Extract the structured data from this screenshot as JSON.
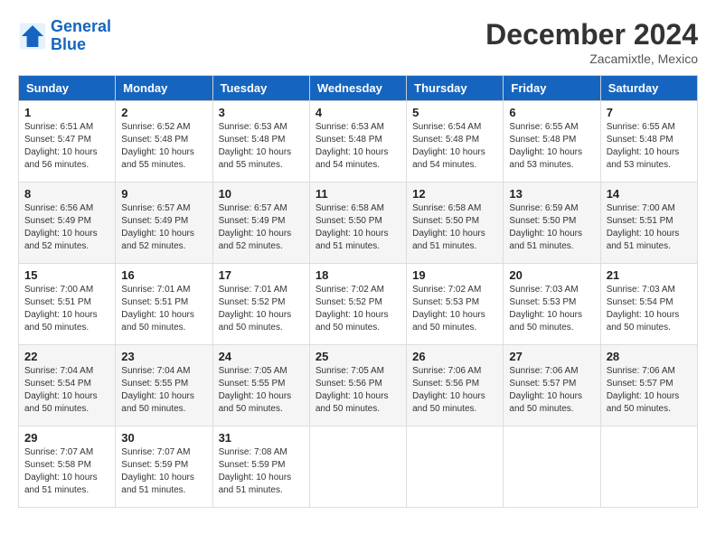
{
  "logo": {
    "line1": "General",
    "line2": "Blue"
  },
  "title": "December 2024",
  "location": "Zacamixtle, Mexico",
  "days_of_week": [
    "Sunday",
    "Monday",
    "Tuesday",
    "Wednesday",
    "Thursday",
    "Friday",
    "Saturday"
  ],
  "weeks": [
    [
      {
        "day": "1",
        "sunrise": "6:51 AM",
        "sunset": "5:47 PM",
        "daylight": "10 hours and 56 minutes."
      },
      {
        "day": "2",
        "sunrise": "6:52 AM",
        "sunset": "5:48 PM",
        "daylight": "10 hours and 55 minutes."
      },
      {
        "day": "3",
        "sunrise": "6:53 AM",
        "sunset": "5:48 PM",
        "daylight": "10 hours and 55 minutes."
      },
      {
        "day": "4",
        "sunrise": "6:53 AM",
        "sunset": "5:48 PM",
        "daylight": "10 hours and 54 minutes."
      },
      {
        "day": "5",
        "sunrise": "6:54 AM",
        "sunset": "5:48 PM",
        "daylight": "10 hours and 54 minutes."
      },
      {
        "day": "6",
        "sunrise": "6:55 AM",
        "sunset": "5:48 PM",
        "daylight": "10 hours and 53 minutes."
      },
      {
        "day": "7",
        "sunrise": "6:55 AM",
        "sunset": "5:48 PM",
        "daylight": "10 hours and 53 minutes."
      }
    ],
    [
      {
        "day": "8",
        "sunrise": "6:56 AM",
        "sunset": "5:49 PM",
        "daylight": "10 hours and 52 minutes."
      },
      {
        "day": "9",
        "sunrise": "6:57 AM",
        "sunset": "5:49 PM",
        "daylight": "10 hours and 52 minutes."
      },
      {
        "day": "10",
        "sunrise": "6:57 AM",
        "sunset": "5:49 PM",
        "daylight": "10 hours and 52 minutes."
      },
      {
        "day": "11",
        "sunrise": "6:58 AM",
        "sunset": "5:50 PM",
        "daylight": "10 hours and 51 minutes."
      },
      {
        "day": "12",
        "sunrise": "6:58 AM",
        "sunset": "5:50 PM",
        "daylight": "10 hours and 51 minutes."
      },
      {
        "day": "13",
        "sunrise": "6:59 AM",
        "sunset": "5:50 PM",
        "daylight": "10 hours and 51 minutes."
      },
      {
        "day": "14",
        "sunrise": "7:00 AM",
        "sunset": "5:51 PM",
        "daylight": "10 hours and 51 minutes."
      }
    ],
    [
      {
        "day": "15",
        "sunrise": "7:00 AM",
        "sunset": "5:51 PM",
        "daylight": "10 hours and 50 minutes."
      },
      {
        "day": "16",
        "sunrise": "7:01 AM",
        "sunset": "5:51 PM",
        "daylight": "10 hours and 50 minutes."
      },
      {
        "day": "17",
        "sunrise": "7:01 AM",
        "sunset": "5:52 PM",
        "daylight": "10 hours and 50 minutes."
      },
      {
        "day": "18",
        "sunrise": "7:02 AM",
        "sunset": "5:52 PM",
        "daylight": "10 hours and 50 minutes."
      },
      {
        "day": "19",
        "sunrise": "7:02 AM",
        "sunset": "5:53 PM",
        "daylight": "10 hours and 50 minutes."
      },
      {
        "day": "20",
        "sunrise": "7:03 AM",
        "sunset": "5:53 PM",
        "daylight": "10 hours and 50 minutes."
      },
      {
        "day": "21",
        "sunrise": "7:03 AM",
        "sunset": "5:54 PM",
        "daylight": "10 hours and 50 minutes."
      }
    ],
    [
      {
        "day": "22",
        "sunrise": "7:04 AM",
        "sunset": "5:54 PM",
        "daylight": "10 hours and 50 minutes."
      },
      {
        "day": "23",
        "sunrise": "7:04 AM",
        "sunset": "5:55 PM",
        "daylight": "10 hours and 50 minutes."
      },
      {
        "day": "24",
        "sunrise": "7:05 AM",
        "sunset": "5:55 PM",
        "daylight": "10 hours and 50 minutes."
      },
      {
        "day": "25",
        "sunrise": "7:05 AM",
        "sunset": "5:56 PM",
        "daylight": "10 hours and 50 minutes."
      },
      {
        "day": "26",
        "sunrise": "7:06 AM",
        "sunset": "5:56 PM",
        "daylight": "10 hours and 50 minutes."
      },
      {
        "day": "27",
        "sunrise": "7:06 AM",
        "sunset": "5:57 PM",
        "daylight": "10 hours and 50 minutes."
      },
      {
        "day": "28",
        "sunrise": "7:06 AM",
        "sunset": "5:57 PM",
        "daylight": "10 hours and 50 minutes."
      }
    ],
    [
      {
        "day": "29",
        "sunrise": "7:07 AM",
        "sunset": "5:58 PM",
        "daylight": "10 hours and 51 minutes."
      },
      {
        "day": "30",
        "sunrise": "7:07 AM",
        "sunset": "5:59 PM",
        "daylight": "10 hours and 51 minutes."
      },
      {
        "day": "31",
        "sunrise": "7:08 AM",
        "sunset": "5:59 PM",
        "daylight": "10 hours and 51 minutes."
      },
      null,
      null,
      null,
      null
    ]
  ]
}
